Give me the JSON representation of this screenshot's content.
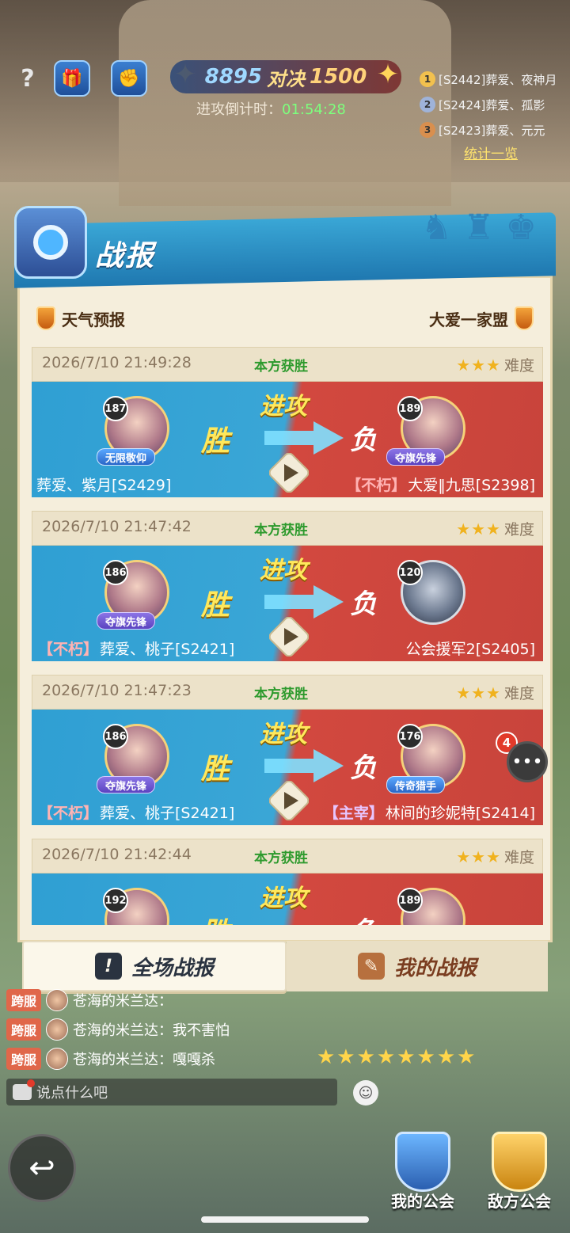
{
  "hud": {
    "ally_score": "8895",
    "vs_label": "对决",
    "enemy_score": "1500",
    "countdown_label": "进攻倒计时：",
    "countdown_time": "01:54:28",
    "rankings": [
      {
        "rank": "1",
        "text": "[S2442]葬爱、夜神月",
        "color": "#f2c14e"
      },
      {
        "rank": "2",
        "text": "[S2424]葬爱、孤影",
        "color": "#9fb3d9"
      },
      {
        "rank": "3",
        "text": "[S2423]葬爱、元元",
        "color": "#d98f4e"
      }
    ],
    "stats_link": "统计一览"
  },
  "panel": {
    "title": "战报",
    "left_team": "天气预报",
    "right_team": "大爱一家盟"
  },
  "labels": {
    "attack": "进攻",
    "win": "胜",
    "lose": "负",
    "difficulty": "难度",
    "stars": "★★★"
  },
  "reports": [
    {
      "time": "2026/7/10 21:49:28",
      "result": "本方获胜",
      "left_level": "187",
      "left_title": "无限敬仰",
      "left_tag": "",
      "left_name": "葬爱、紫月[S2429]",
      "right_level": "189",
      "right_title": "夺旗先锋",
      "right_tag": "【不朽】",
      "right_name": "大爱‖九思[S2398]"
    },
    {
      "time": "2026/7/10 21:47:42",
      "result": "本方获胜",
      "left_level": "186",
      "left_title": "夺旗先锋",
      "left_tag": "【不朽】",
      "left_name": "葬爱、桃子[S2421]",
      "right_level": "120",
      "right_title": "",
      "right_tag": "",
      "right_name": "公会援军2[S2405]"
    },
    {
      "time": "2026/7/10 21:47:23",
      "result": "本方获胜",
      "left_level": "186",
      "left_title": "夺旗先锋",
      "left_tag": "【不朽】",
      "left_name": "葬爱、桃子[S2421]",
      "right_level": "176",
      "right_title": "传奇猎手",
      "right_tag": "【主宰】",
      "right_name": "林间的珍妮特[S2414]"
    },
    {
      "time": "2026/7/10 21:42:44",
      "result": "本方获胜",
      "left_level": "192",
      "left_title": "",
      "left_tag": "",
      "left_name": "",
      "right_level": "189",
      "right_title": "",
      "right_tag": "",
      "right_name": ""
    }
  ],
  "chat_badge_count": "4",
  "tabs": {
    "all": "全场战报",
    "mine": "我的战报"
  },
  "chat": {
    "channel": "跨服",
    "lines": [
      "苍海的米兰达：",
      "苍海的米兰达：我不害怕",
      "苍海的米兰达：嘎嘎杀"
    ],
    "input_placeholder": "说点什么吧"
  },
  "nav": {
    "my_guild": "我的公会",
    "enemy_guild": "敌方公会"
  }
}
